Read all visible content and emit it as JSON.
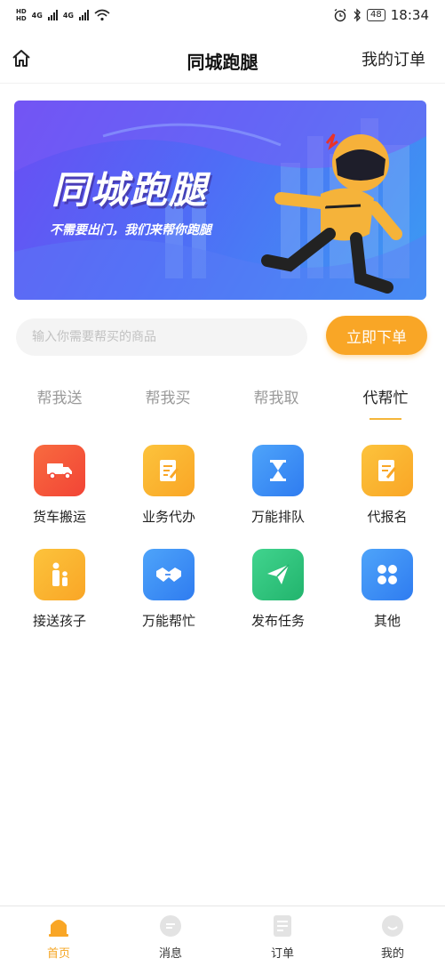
{
  "status_bar": {
    "time": "18:34",
    "battery": "48",
    "network_1": "4G",
    "network_2": "4G"
  },
  "header": {
    "title": "同城跑腿",
    "orders_link": "我的订单"
  },
  "banner": {
    "title": "同城跑腿",
    "subtitle": "不需要出门，我们来帮你跑腿"
  },
  "search": {
    "placeholder": "输入你需要帮买的商品",
    "button_label": "立即下单"
  },
  "tabs": [
    {
      "label": "帮我送"
    },
    {
      "label": "帮我买"
    },
    {
      "label": "帮我取"
    },
    {
      "label": "代帮忙"
    }
  ],
  "active_tab": "代帮忙",
  "services": [
    {
      "label": "货车搬运",
      "icon": "truck-icon",
      "color": "#f4563c"
    },
    {
      "label": "业务代办",
      "icon": "document-icon",
      "color": "#fbb62c"
    },
    {
      "label": "万能排队",
      "icon": "hourglass-icon",
      "color": "#3d8ff6"
    },
    {
      "label": "代报名",
      "icon": "form-edit-icon",
      "color": "#fbb62c"
    },
    {
      "label": "接送孩子",
      "icon": "parent-child-icon",
      "color": "#fbb62c"
    },
    {
      "label": "万能帮忙",
      "icon": "handshake-icon",
      "color": "#3d8ff6"
    },
    {
      "label": "发布任务",
      "icon": "paper-plane-icon",
      "color": "#30c47f"
    },
    {
      "label": "其他",
      "icon": "grid-dots-icon",
      "color": "#3d8ff6"
    }
  ],
  "bottom_nav": [
    {
      "label": "首页",
      "icon": "home-lamp-icon"
    },
    {
      "label": "消息",
      "icon": "message-icon"
    },
    {
      "label": "订单",
      "icon": "order-list-icon"
    },
    {
      "label": "我的",
      "icon": "profile-icon"
    }
  ],
  "colors": {
    "accent": "#f9a626",
    "tab_underline": "#f5b63a"
  }
}
